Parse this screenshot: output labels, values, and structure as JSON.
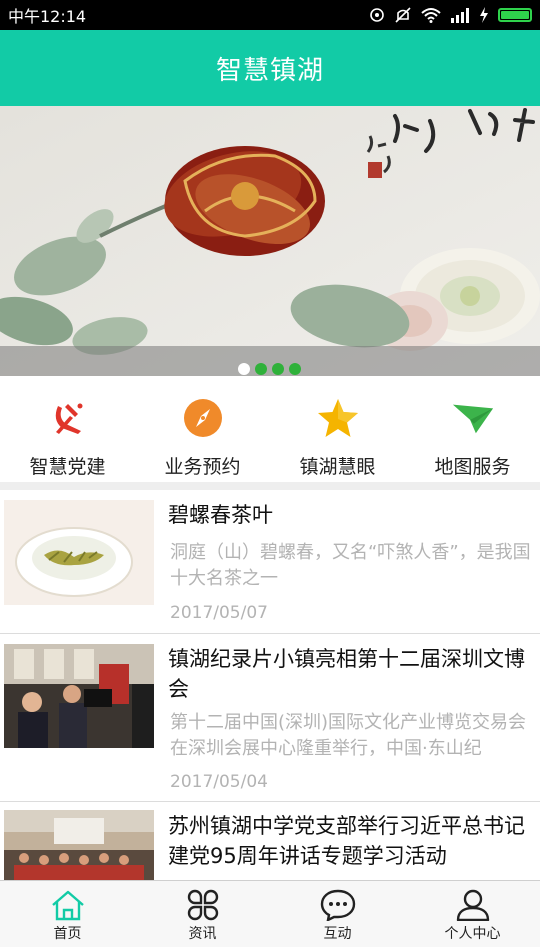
{
  "status_bar": {
    "time": "中午12:14"
  },
  "header": {
    "title": "智慧镇湖"
  },
  "banner": {
    "active_dot": 0,
    "dot_count": 4
  },
  "quick_nav": [
    {
      "label": "智慧党建",
      "icon": "party-emblem-icon",
      "color": "#e0352b"
    },
    {
      "label": "业务预约",
      "icon": "compass-icon",
      "color": "#f08a2a"
    },
    {
      "label": "镇湖慧眼",
      "icon": "star-icon",
      "color": "#f5b400"
    },
    {
      "label": "地图服务",
      "icon": "paper-plane-icon",
      "color": "#3cb44b"
    }
  ],
  "news": [
    {
      "title": "碧螺春茶叶",
      "summary": "洞庭（山）碧螺春，又名“吓煞人香”，是我国十大名茶之一",
      "date": "2017/05/07"
    },
    {
      "title": "镇湖纪录片小镇亮相第十二届深圳文博会",
      "summary": "第十二届中国(深圳)国际文化产业博览交易会在深圳会展中心隆重举行，中国·东山纪",
      "date": "2017/05/04"
    },
    {
      "title": "苏州镇湖中学党支部举行习近平总书记建党95周年讲话专题学习活动",
      "summary": "",
      "date": ""
    }
  ],
  "tabs": [
    {
      "label": "首页",
      "icon": "home-icon",
      "active": true
    },
    {
      "label": "资讯",
      "icon": "news-clover-icon",
      "active": false
    },
    {
      "label": "互动",
      "icon": "chat-bubble-icon",
      "active": false
    },
    {
      "label": "个人中心",
      "icon": "user-icon",
      "active": false
    }
  ],
  "colors": {
    "accent": "#12cba6",
    "tab_active": "#12cba6"
  }
}
